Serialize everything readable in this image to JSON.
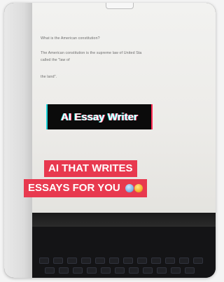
{
  "doc": {
    "question": "What is the American constitution?",
    "answer_line1": "The American constitution is the supreme law of United Sta",
    "answer_line2": "called the \"law of",
    "prompt_line": "the land\"."
  },
  "overlay": {
    "black_label": "AI Essay Writer",
    "red_line1": "AI THAT WRITES",
    "red_line2": "ESSAYS FOR YOU"
  },
  "icons": [
    "robot-emoji",
    "star-struck-emoji"
  ]
}
